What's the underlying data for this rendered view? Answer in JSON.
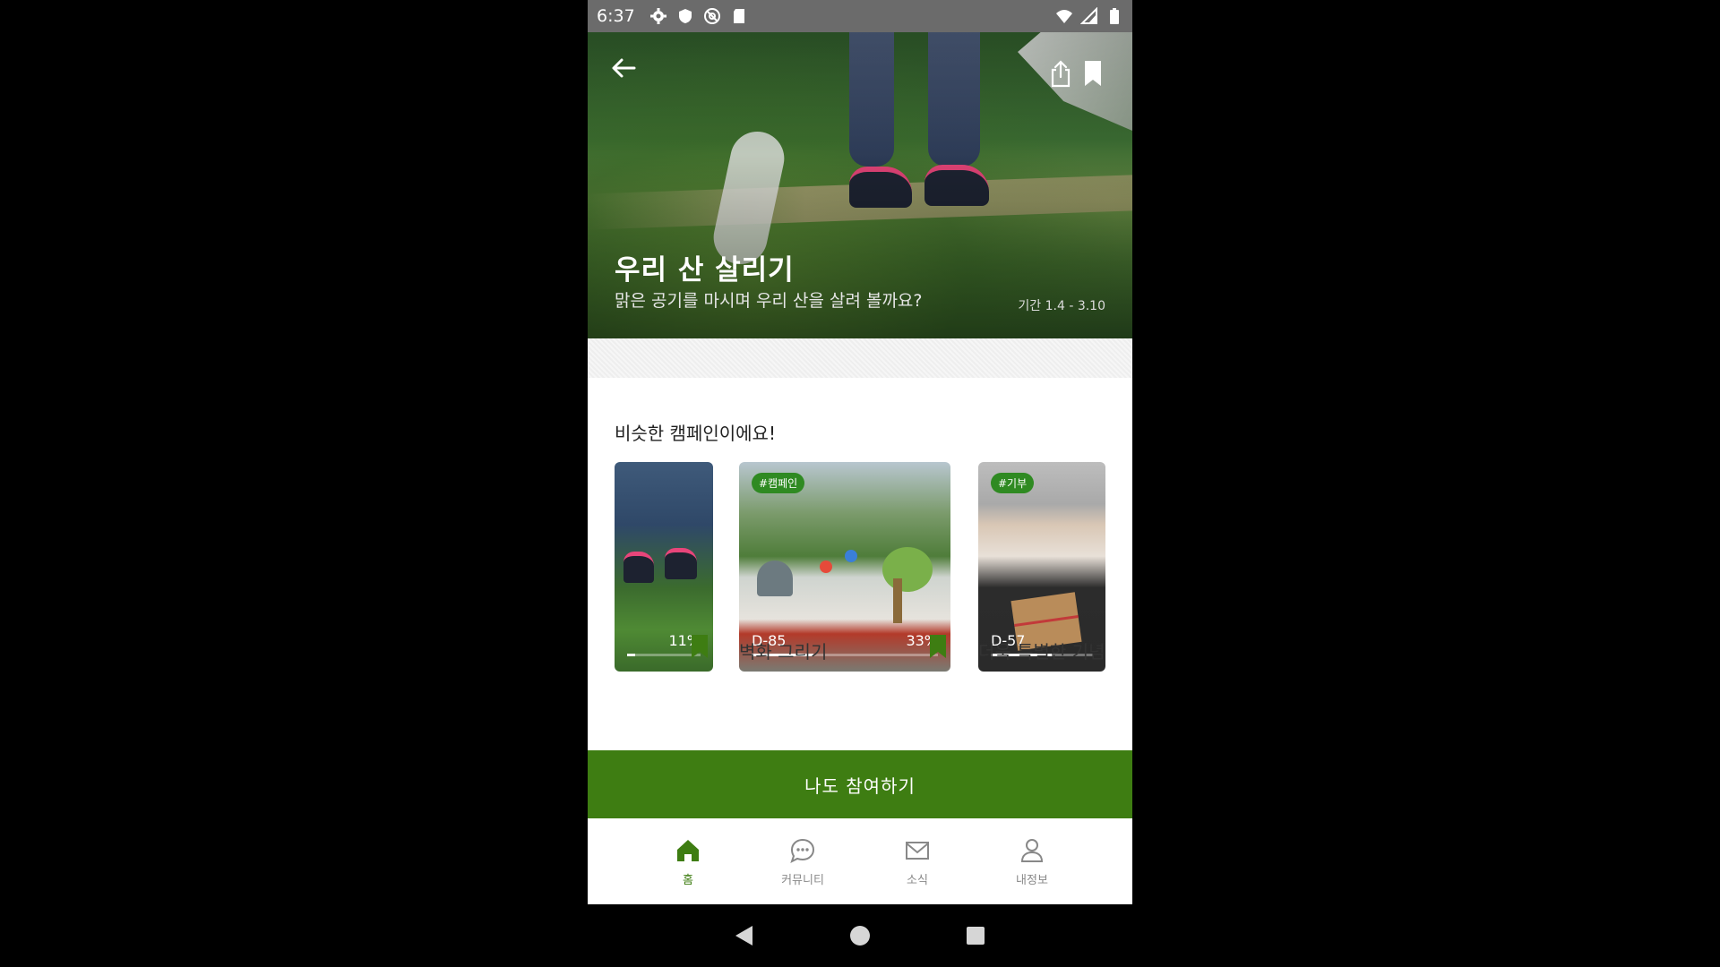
{
  "status_bar": {
    "time": "6:37",
    "icons": [
      "gear-icon",
      "shield-icon",
      "at-sign-icon",
      "sd-card-icon"
    ],
    "right_icons": [
      "wifi-icon",
      "cell-signal-icon",
      "battery-icon"
    ]
  },
  "hero": {
    "title": "우리 산 살리기",
    "subtitle": "맑은 공기를 마시며 우리 산을 살려 볼까요?",
    "period": "기간 1.4 - 3.10",
    "icons": [
      "back-arrow-icon",
      "share-icon",
      "bookmark-icon"
    ]
  },
  "similar": {
    "title": "비슷한 캠페인이에요!",
    "cards": [
      {
        "dday": "",
        "percent": "11%",
        "progress": 0.11,
        "tag": "",
        "label": ""
      },
      {
        "dday": "D-85",
        "percent": "33%",
        "progress": 0.33,
        "tag": "#캠페인",
        "label": "벽화 그리기"
      },
      {
        "dday": "D-57",
        "percent": "",
        "progress": 0.6,
        "tag": "#기부",
        "label": "더욱 특별한 기념"
      }
    ]
  },
  "join_button": {
    "label": "나도 참여하기"
  },
  "bottom_nav": {
    "items": [
      {
        "label": "홈",
        "icon": "home-icon",
        "active": true
      },
      {
        "label": "커뮤니티",
        "icon": "chat-bubble-icon",
        "active": false
      },
      {
        "label": "소식",
        "icon": "mail-icon",
        "active": false
      },
      {
        "label": "내정보",
        "icon": "person-icon",
        "active": false
      }
    ]
  },
  "colors": {
    "primary_green": "#3e7d12",
    "tag_green": "#2f8a22",
    "status_bar": "#6b6b6b"
  },
  "system_nav": [
    "back-triangle-icon",
    "home-circle-icon",
    "recents-square-icon"
  ]
}
